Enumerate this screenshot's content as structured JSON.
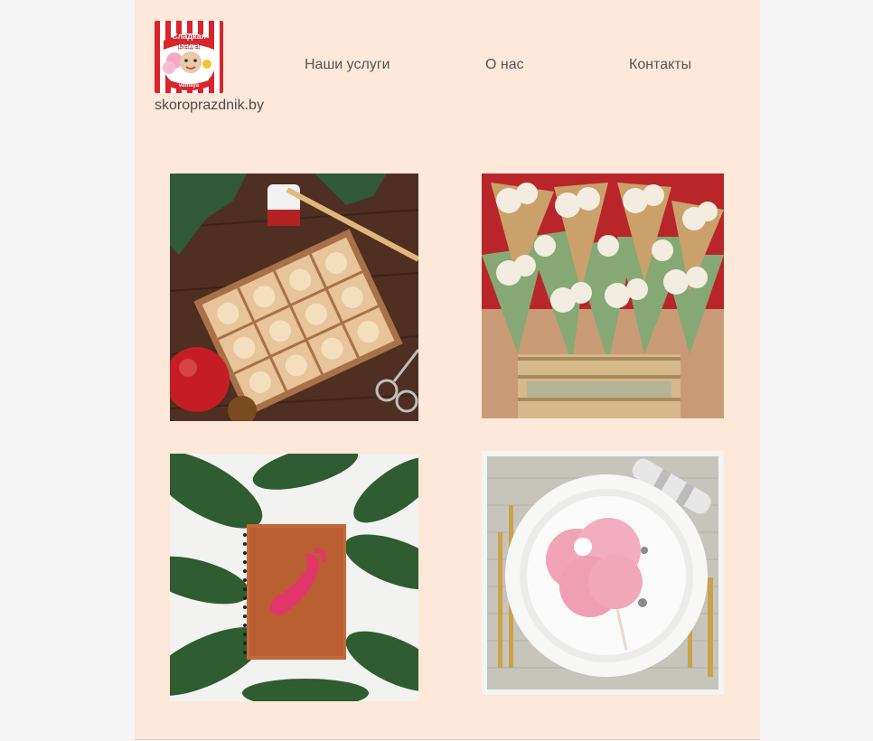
{
  "header": {
    "logo": {
      "text_top": "Сладкая",
      "text_main": "вата",
      "text_bottom": "vatnaya"
    },
    "site_domain": "skoroprazdnik.by",
    "nav": [
      {
        "label": "Наши услуги"
      },
      {
        "label": "О нас"
      },
      {
        "label": "Контакты"
      }
    ]
  },
  "gallery": [
    {
      "subject": "wooden christmas ornaments box"
    },
    {
      "subject": "popcorn cones in basket"
    },
    {
      "subject": "wooden notebook with flamingo"
    },
    {
      "subject": "cotton candy on plate"
    }
  ],
  "colors": {
    "page_background": "#fee8d9",
    "outer_background": "#f5f5f5",
    "nav_text": "#555555"
  }
}
